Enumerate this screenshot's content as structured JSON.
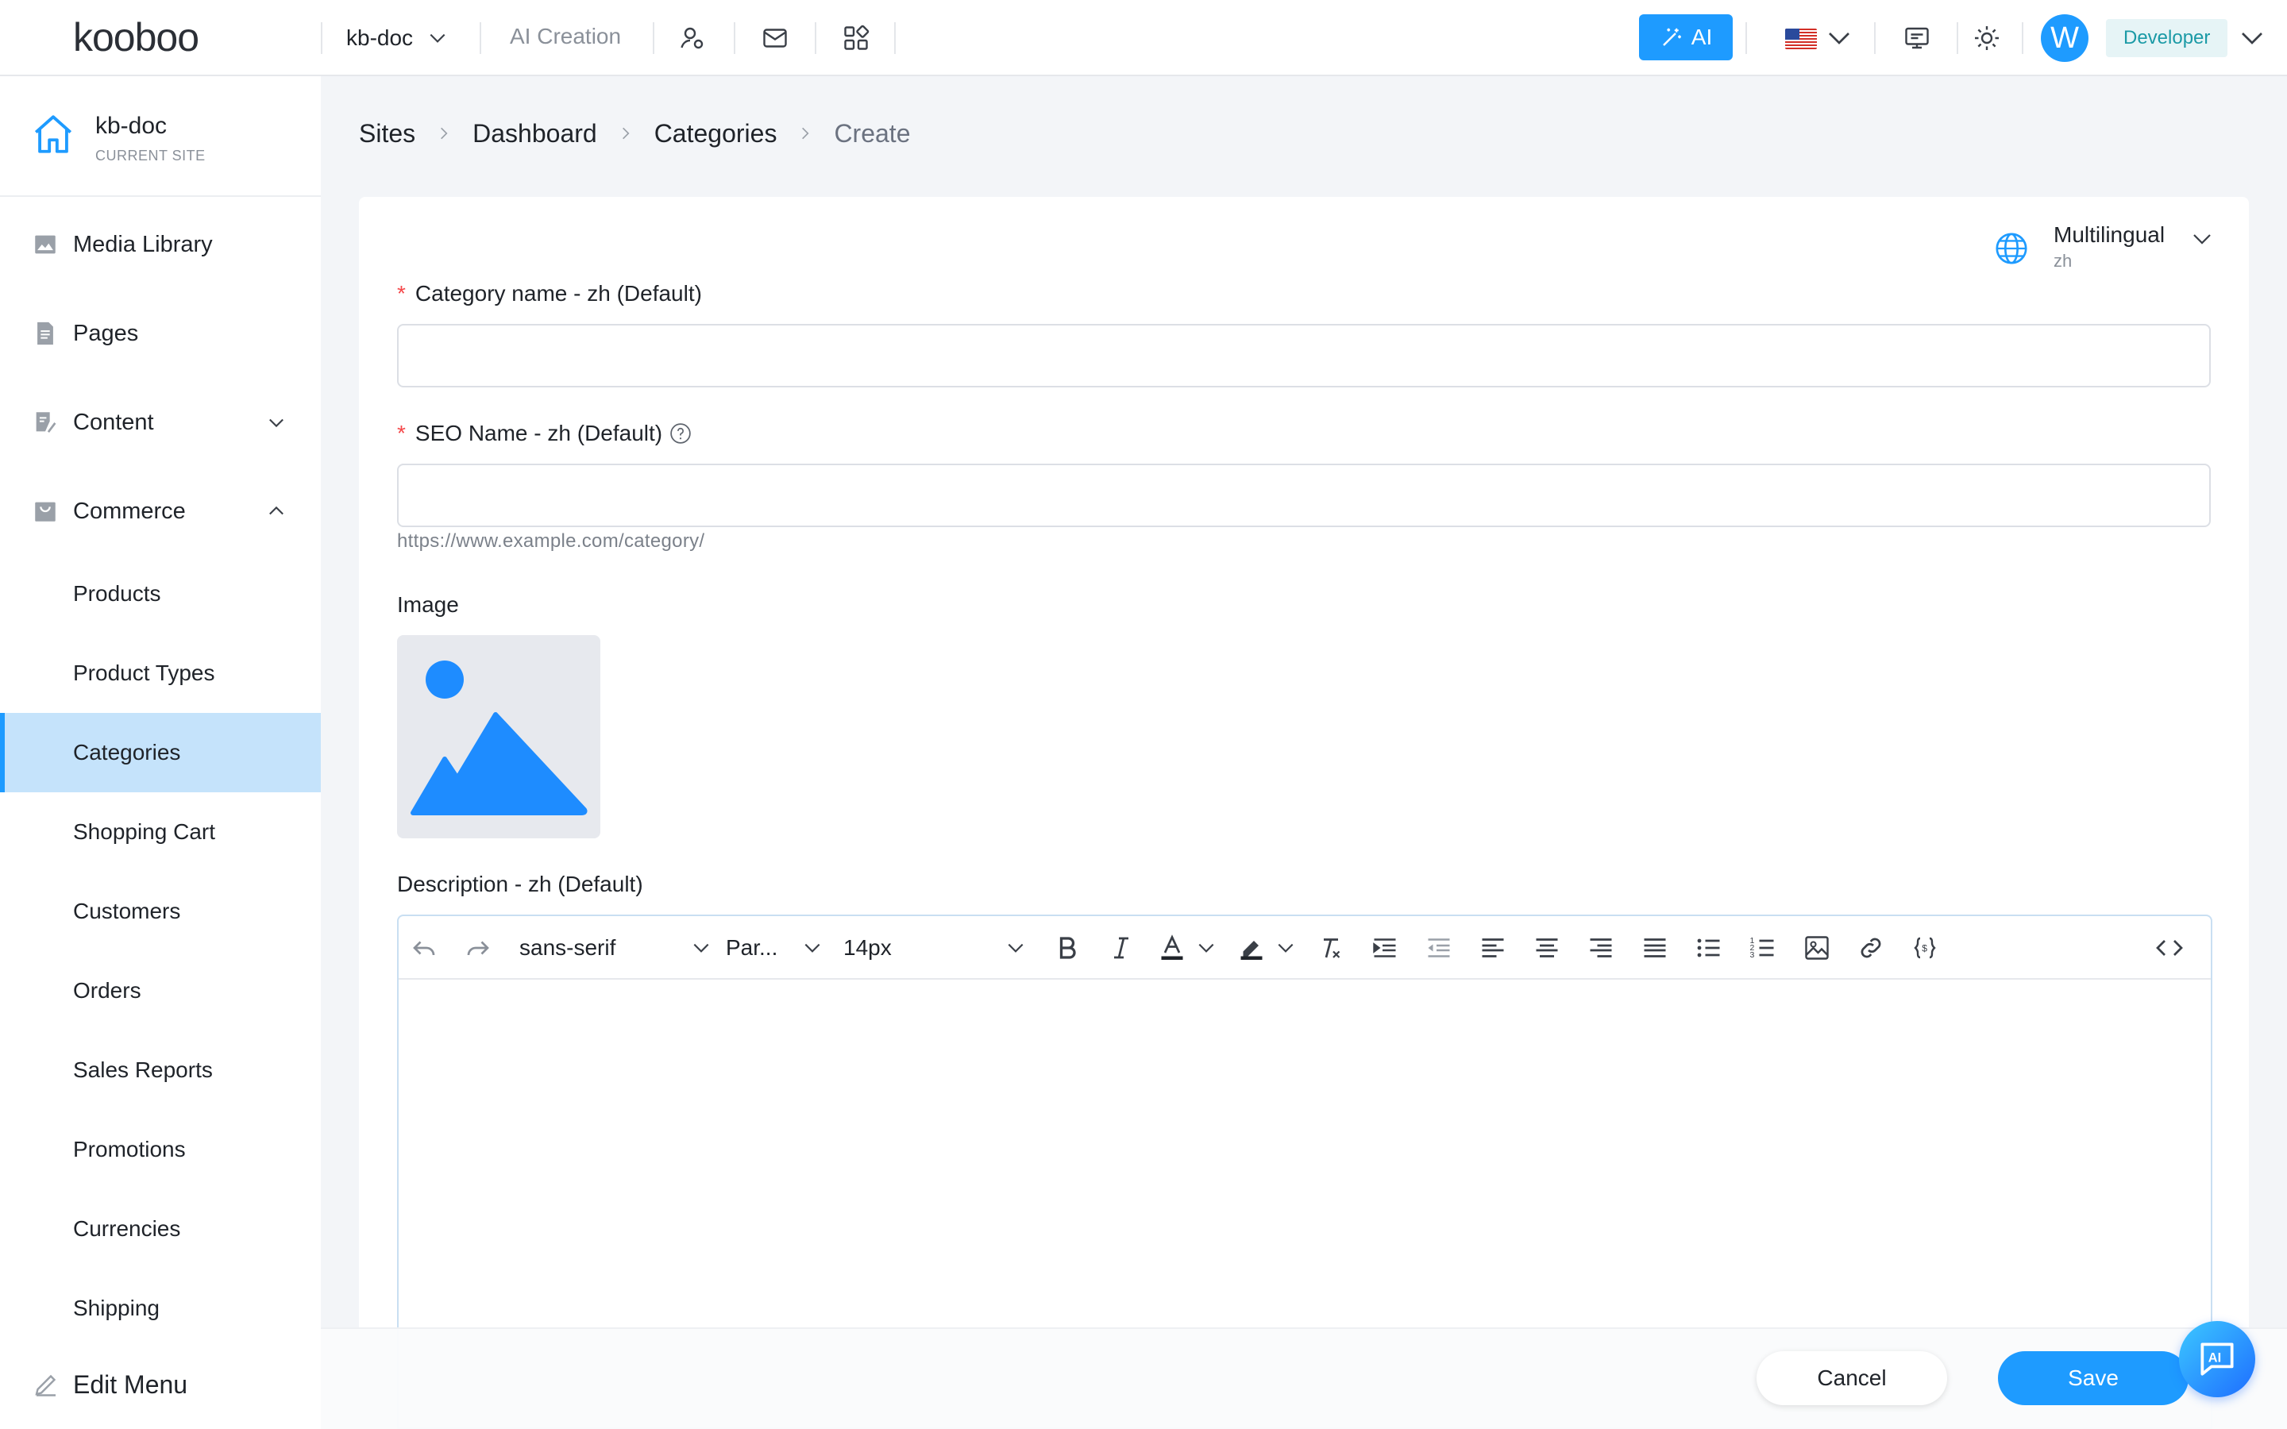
{
  "header": {
    "logo_text": "kooboo",
    "site_selector": "kb-doc",
    "ai_creation": "AI Creation",
    "ai_button": "AI",
    "avatar_letter": "W",
    "role": "Developer",
    "accent_color": "#1e9bff"
  },
  "sidebar": {
    "current_site": {
      "name": "kb-doc",
      "subtitle": "CURRENT SITE"
    },
    "items": [
      {
        "label": "Media Library",
        "icon": "image-icon"
      },
      {
        "label": "Pages",
        "icon": "document-icon"
      },
      {
        "label": "Content",
        "icon": "edit-document-icon",
        "expanded": false
      },
      {
        "label": "Commerce",
        "icon": "bag-icon",
        "expanded": true
      }
    ],
    "commerce_children": [
      {
        "label": "Products"
      },
      {
        "label": "Product Types"
      },
      {
        "label": "Categories",
        "active": true
      },
      {
        "label": "Shopping Cart"
      },
      {
        "label": "Customers"
      },
      {
        "label": "Orders"
      },
      {
        "label": "Sales Reports"
      },
      {
        "label": "Promotions"
      },
      {
        "label": "Currencies"
      },
      {
        "label": "Shipping"
      }
    ],
    "edit_menu": "Edit Menu"
  },
  "breadcrumb": [
    "Sites",
    "Dashboard",
    "Categories",
    "Create"
  ],
  "multilingual": {
    "label": "Multilingual",
    "current": "zh"
  },
  "form": {
    "category_name_label": "Category name - zh (Default)",
    "category_name_value": "",
    "seo_name_label": "SEO Name - zh (Default)",
    "seo_name_value": "",
    "seo_hint": "https://www.example.com/category/",
    "image_label": "Image",
    "description_label": "Description - zh (Default)"
  },
  "editor_toolbar": {
    "font_family": "sans-serif",
    "block_format": "Par...",
    "font_size": "14px"
  },
  "actions": {
    "cancel": "Cancel",
    "save": "Save"
  },
  "ai_float_label": "AI"
}
